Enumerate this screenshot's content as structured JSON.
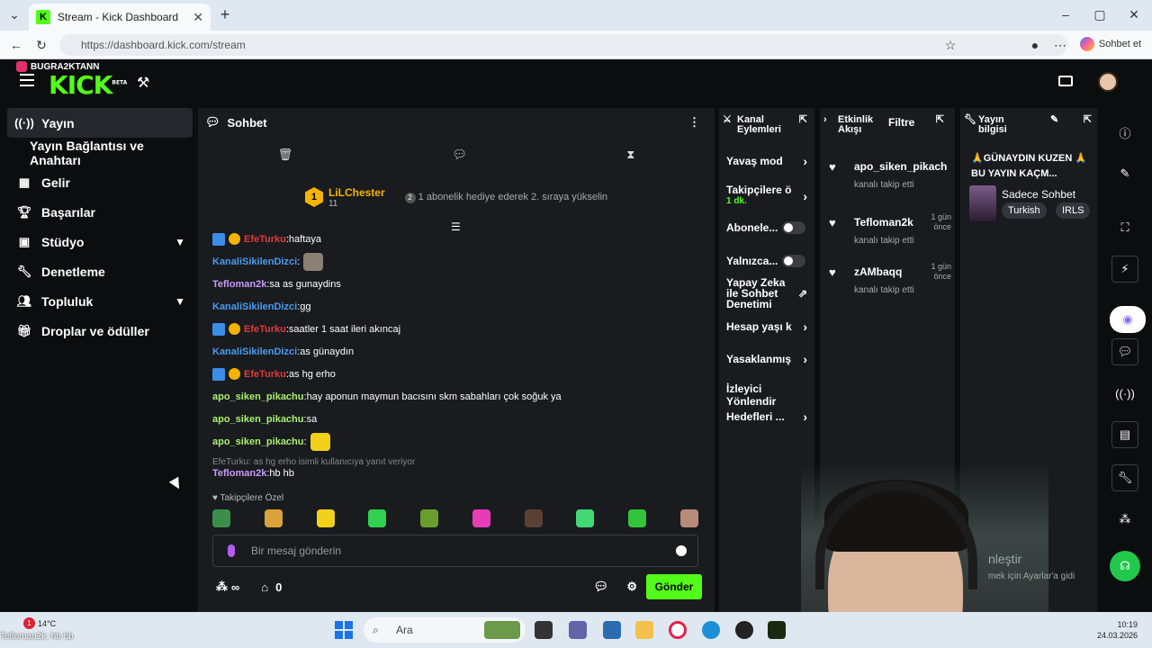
{
  "browser": {
    "tab_title": "Stream - Kick Dashboard",
    "tab_favicon": "K",
    "url": "https://dashboard.kick.com/stream",
    "copilot_label": "Sohbet et"
  },
  "overlay": {
    "streamer_tag": "BUGRA2KTANN"
  },
  "topbar": {
    "logo": "KICK",
    "logo_badge": "BETA"
  },
  "sidebar": {
    "items": [
      {
        "label": "Yayın",
        "icon": "broadcast-icon",
        "active": true
      },
      {
        "label": "Yayın Bağlantısı ve Anahtarı",
        "icon": "",
        "active": false
      },
      {
        "label": "Gelir",
        "icon": "chart-icon",
        "active": false
      },
      {
        "label": "Başarılar",
        "icon": "trophy-icon",
        "active": false
      },
      {
        "label": "Stüdyo",
        "icon": "studio-icon",
        "active": false
      },
      {
        "label": "Denetleme",
        "icon": "wrench-icon",
        "active": false
      },
      {
        "label": "Topluluk",
        "icon": "people-icon",
        "active": false
      },
      {
        "label": "Droplar ve ödüller",
        "icon": "gift-icon",
        "active": false
      }
    ]
  },
  "chat": {
    "title": "Sohbet",
    "pinned": {
      "user": "LiLChester",
      "rank": "1",
      "count": "11",
      "gift_count": "2",
      "message": "1 abonelik hediye ederek 2. sıraya yükselin"
    },
    "messages": [
      {
        "user": "EfeTurku",
        "text": "haftaya",
        "color": "red",
        "badges": true
      },
      {
        "user": "KanaliSikilenDizci",
        "text": "",
        "color": "blue",
        "badges": false,
        "emoji": true
      },
      {
        "user": "Tefloman2k",
        "text": "sa as gunaydins",
        "color": "purple",
        "badges": false
      },
      {
        "user": "KanaliSikilenDizci",
        "text": "gg",
        "color": "blue",
        "badges": false
      },
      {
        "user": "EfeTurku",
        "text": "saatler 1 saat ileri akıncaj",
        "color": "red",
        "badges": true
      },
      {
        "user": "KanaliSikilenDizci",
        "text": "as günaydın",
        "color": "blue",
        "badges": false
      },
      {
        "user": "EfeTurku",
        "text": "as hg erho",
        "color": "red",
        "badges": true
      },
      {
        "user": "apo_siken_pikachu",
        "text": "hay aponun maymun bacısını skm sabahları çok soğuk ya",
        "color": "green",
        "badges": false
      },
      {
        "user": "apo_siken_pikachu",
        "text": "sa",
        "color": "green",
        "badges": false
      },
      {
        "user": "apo_siken_pikachu",
        "text": "",
        "color": "green",
        "badges": false,
        "emoji": true
      }
    ],
    "reply": {
      "context": "EfeTurku: as hg erho isimli kullanıcıya yanıt veriyor",
      "user": "Tefloman2k",
      "text": "hb hb"
    },
    "follow_only_label": "Takipçilere Özel",
    "input_placeholder": "Bir mesaj gönderin",
    "points": "∞",
    "store_count": "0",
    "send_label": "Gönder"
  },
  "channel_actions": {
    "title_line1": "Kanal",
    "title_line2": "Eylemleri",
    "items": [
      {
        "label": "Yavaş mod",
        "type": "arrow"
      },
      {
        "label": "Takipçilere ö",
        "sub": "1 dk.",
        "type": "arrow"
      },
      {
        "label": "Abonele...",
        "type": "toggle"
      },
      {
        "label": "Yalnızca...",
        "type": "toggle"
      },
      {
        "label": "Yapay Zeka ile Sohbet Denetimi",
        "type": "external"
      },
      {
        "label": "Hesap yaşı k",
        "type": "arrow"
      },
      {
        "label": "Yasaklanmış",
        "type": "arrow"
      },
      {
        "label": "İzleyici Yönlendir",
        "type": "none"
      },
      {
        "label": "Hedefleri ...",
        "type": "arrow"
      }
    ]
  },
  "activity": {
    "title_line1": "Etkinlik",
    "title_line2": "Akışı",
    "filter_label": "Filtre",
    "items": [
      {
        "user": "apo_siken_pikach",
        "action": "kanalı takip etti",
        "time": ""
      },
      {
        "user": "Tefloman2k",
        "action": "kanalı takip etti",
        "time": "1 gün önce"
      },
      {
        "user": "zAMbaqq",
        "action": "kanalı takip etti",
        "time": "1 gün önce"
      }
    ]
  },
  "stream_info": {
    "title_line1": "Yayın",
    "title_line2": "bilgisi",
    "stream_title": "🙏GÜNAYDIN KUZEN 🙏BU YAYIN KAÇM...",
    "category": "Sadece Sohbet",
    "tags": [
      "Turkish",
      "IRLS"
    ]
  },
  "overlay_text": {
    "line1": "nleştir",
    "line2": "mek için Ayarlar'a gidi"
  },
  "taskbar": {
    "weather": "14°C",
    "weather_alert": "1",
    "search_placeholder": "Ara",
    "chat_overlay": "Tefloman2k: hb hb",
    "time": "10:19",
    "date": "24.03.2026"
  }
}
